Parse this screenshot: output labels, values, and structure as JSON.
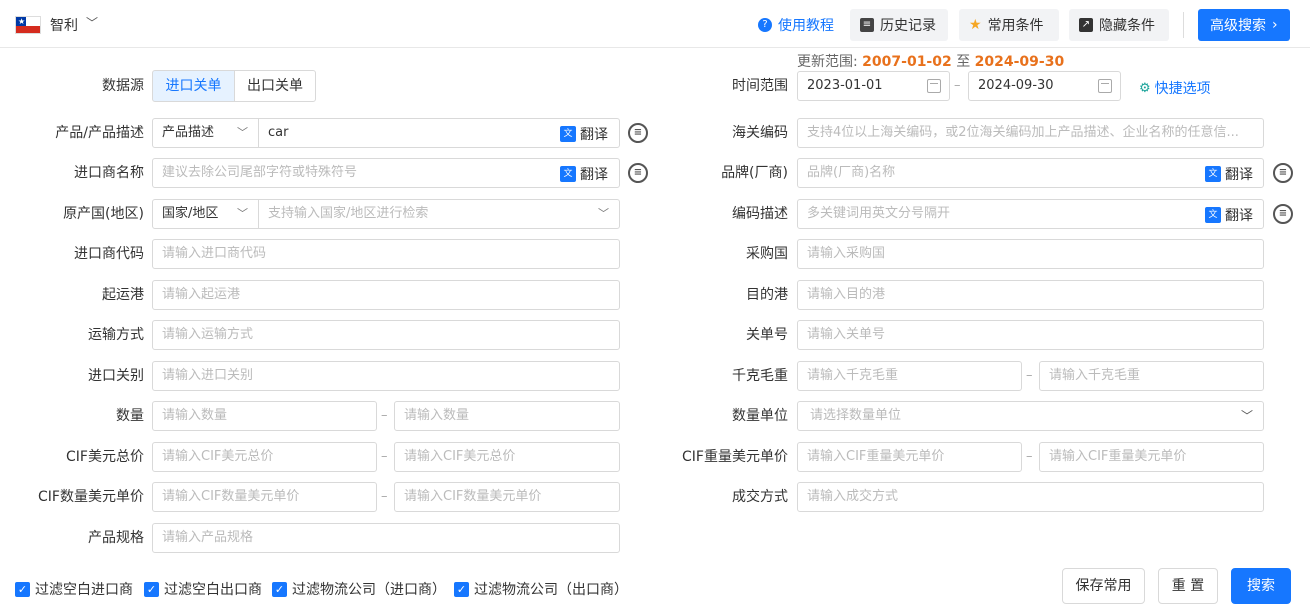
{
  "header": {
    "country": "智利",
    "tutorial_label": "使用教程",
    "history_label": "历史记录",
    "common_label": "常用条件",
    "hide_label": "隐藏条件",
    "advanced_label": "高级搜索",
    "update_prefix": "更新范围:",
    "update_from": "2007-01-02",
    "update_to_word": "至",
    "update_to": "2024-09-30"
  },
  "left": {
    "datasource_label": "数据源",
    "import_tab": "进口关单",
    "export_tab": "出口关单",
    "product_label": "产品/产品描述",
    "product_select": "产品描述",
    "product_value": "car",
    "translate": "翻译",
    "importer_label": "进口商名称",
    "importer_placeholder": "建议去除公司尾部字符或特殊符号",
    "origin_label": "原产国(地区)",
    "origin_select": "国家/地区",
    "origin_placeholder": "支持输入国家/地区进行检索",
    "importer_code_label": "进口商代码",
    "importer_code_placeholder": "请输入进口商代码",
    "port_label": "起运港",
    "port_placeholder": "请输入起运港",
    "transport_label": "运输方式",
    "transport_placeholder": "请输入运输方式",
    "customs_label": "进口关别",
    "customs_placeholder": "请输入进口关别",
    "qty_label": "数量",
    "qty_placeholder": "请输入数量",
    "cif_total_label": "CIF美元总价",
    "cif_total_placeholder": "请输入CIF美元总价",
    "cif_unit_label": "CIF数量美元单价",
    "cif_unit_placeholder": "请输入CIF数量美元单价",
    "spec_label": "产品规格",
    "spec_placeholder": "请输入产品规格"
  },
  "right": {
    "time_label": "时间范围",
    "date_from": "2023-01-01",
    "date_to": "2024-09-30",
    "quick_label": "快捷选项",
    "hs_label": "海关编码",
    "hs_placeholder": "支持4位以上海关编码，或2位海关编码加上产品描述、企业名称的任意信...",
    "brand_label": "品牌(厂商)",
    "brand_placeholder": "品牌(厂商)名称",
    "code_desc_label": "编码描述",
    "code_desc_placeholder": "多关键词用英文分号隔开",
    "buyer_country_label": "采购国",
    "buyer_country_placeholder": "请输入采购国",
    "dest_port_label": "目的港",
    "dest_port_placeholder": "请输入目的港",
    "bill_label": "关单号",
    "bill_placeholder": "请输入关单号",
    "weight_label": "千克毛重",
    "weight_placeholder": "请输入千克毛重",
    "unit_label": "数量单位",
    "unit_placeholder": "请选择数量单位",
    "cif_weight_label": "CIF重量美元单价",
    "cif_weight_placeholder": "请输入CIF重量美元单价",
    "deal_label": "成交方式",
    "deal_placeholder": "请输入成交方式"
  },
  "footer": {
    "filter1": "过滤空白进口商",
    "filter2": "过滤空白出口商",
    "filter3": "过滤物流公司（进口商）",
    "filter4": "过滤物流公司（出口商）",
    "save_label": "保存常用",
    "reset_label": "重 置",
    "search_label": "搜索"
  },
  "colors": {
    "accent": "#1677ff",
    "highlight": "#e8711c"
  }
}
